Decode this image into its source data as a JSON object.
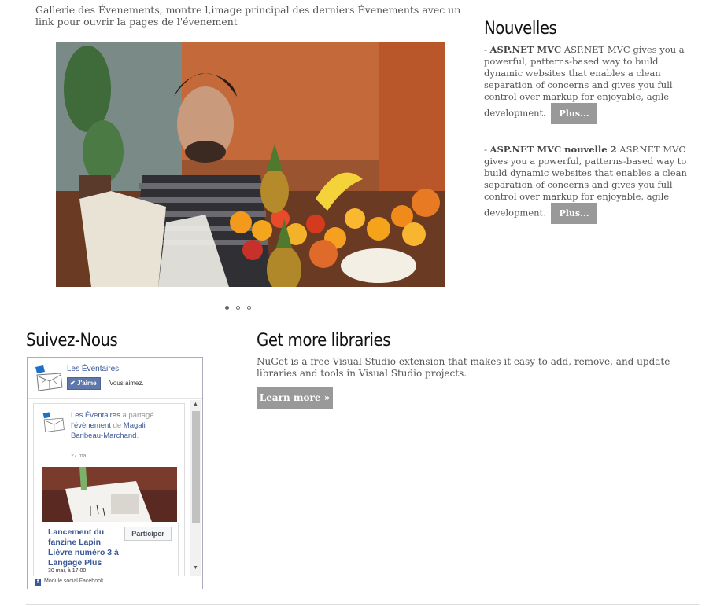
{
  "intro": {
    "text": "Gallerie des Évenements, montre l,image principal des derniers Évenements avec un link pour ouvrir la pages de l'évenement"
  },
  "carousel": {
    "image_alt": "Photo: homme souriant avec des fruits et légumes",
    "dots": 3,
    "active_index": 0
  },
  "news": {
    "title": "Nouvelles",
    "items": [
      {
        "prefix": "- ",
        "heading": "ASP.NET MVC",
        "body": " ASP.NET MVC gives you a powerful, patterns-based way to build dynamic websites that enables a clean separation of concerns and gives you full control over markup for enjoyable, agile development.",
        "button": "Plus..."
      },
      {
        "prefix": "- ",
        "heading": "ASP.NET MVC nouvelle 2",
        "body": " ASP.NET MVC gives you a powerful, patterns-based way to build dynamic websites that enables a clean separation of concerns and gives you full control over markup for enjoyable, agile development.",
        "button": "Plus..."
      }
    ]
  },
  "social": {
    "title": "Suivez-Nous",
    "page_name": "Les Éventaires",
    "like_button": "J'aime",
    "like_status": "Vous aimez.",
    "post": {
      "author": "Les Éventaires",
      "action_1": " a partagé l'",
      "action_link": "évènement",
      "action_2": " de ",
      "target": "Magali Baribeau-Marchand",
      "end": ".",
      "date": "27 mai",
      "event_title": "Lancement du fanzine Lapin Lièvre numéro 3 à Langage Plus",
      "event_date": "30 mai, à 17:00",
      "participate_button": "Participer"
    },
    "footer": "Module social Facebook",
    "scroll_up": "▲",
    "scroll_down": "▼",
    "facebook_glyph": "f"
  },
  "libraries": {
    "title": "Get more libraries",
    "text": "NuGet is a free Visual Studio extension that makes it easy to add, remove, and update libraries and tools in Visual Studio projects.",
    "button": "Learn more »"
  }
}
